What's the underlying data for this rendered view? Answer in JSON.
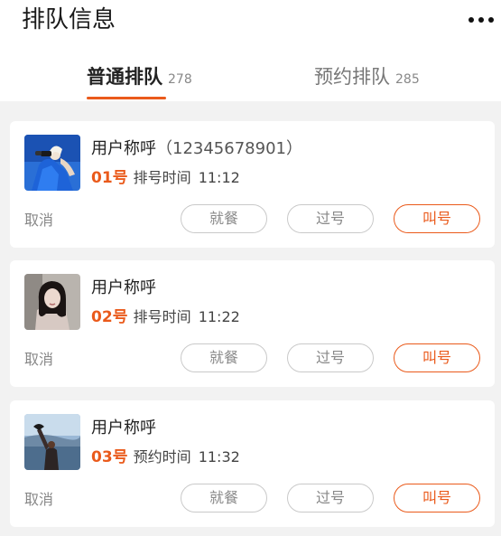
{
  "header": {
    "title": "排队信息",
    "more_icon": "more-dots-icon"
  },
  "tabs": [
    {
      "label": "普通排队",
      "count": "278",
      "active": true
    },
    {
      "label": "预约排队",
      "count": "285",
      "active": false
    }
  ],
  "colors": {
    "accent": "#ea5a1b",
    "muted_border": "#c9c9c9",
    "background": "#f2f2f2"
  },
  "cards": [
    {
      "avatar": "avatar-photo-binoculars",
      "name": "用户称呼",
      "phone": "（12345678901）",
      "number": "01号",
      "time_label": "排号时间",
      "time": "11:12",
      "cancel": "取消",
      "dine": "就餐",
      "skip": "过号",
      "call": "叫号"
    },
    {
      "avatar": "avatar-photo-woman",
      "name": "用户称呼",
      "phone": "",
      "number": "02号",
      "time_label": "排号时间",
      "time": "11:22",
      "cancel": "取消",
      "dine": "就餐",
      "skip": "过号",
      "call": "叫号"
    },
    {
      "avatar": "avatar-photo-lake",
      "name": "用户称呼",
      "phone": "",
      "number": "03号",
      "time_label": "预约时间",
      "time": "11:32",
      "cancel": "取消",
      "dine": "就餐",
      "skip": "过号",
      "call": "叫号"
    }
  ]
}
